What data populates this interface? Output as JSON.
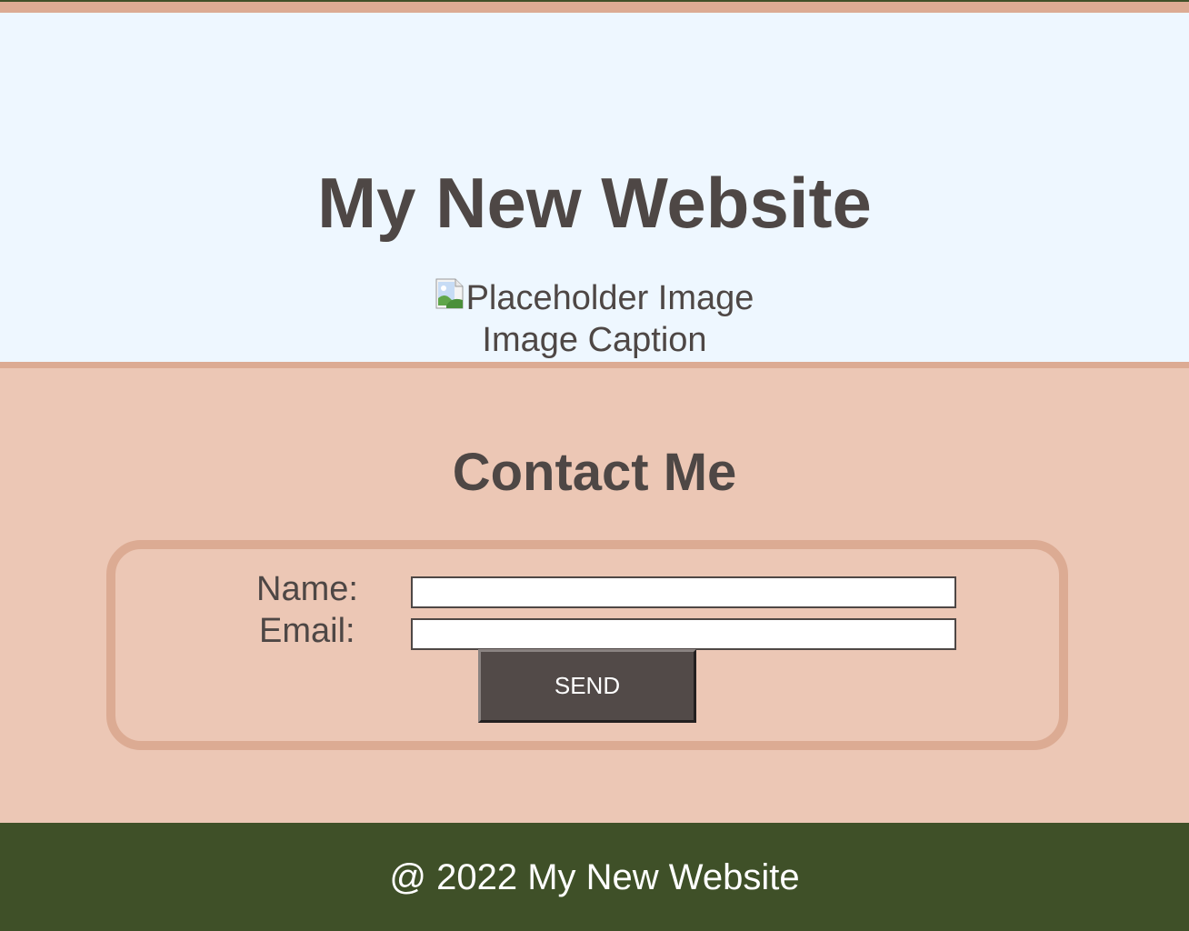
{
  "hero": {
    "title": "My New Website",
    "image_alt": "Placeholder Image",
    "caption": "Image Caption"
  },
  "contact": {
    "title": "Contact Me",
    "name_label": "Name:",
    "email_label": "Email:",
    "name_value": "",
    "email_value": "",
    "send_label": "SEND"
  },
  "footer": {
    "text": "@ 2022 My New Website"
  },
  "colors": {
    "accent_strip": "#dcab93",
    "hero_background": "#eef7ff",
    "contact_background": "#ecc7b5",
    "footer_background": "#3f5028",
    "text": "#4e4745",
    "button": "#524a48"
  },
  "icons": {
    "broken_image": "broken-image-icon"
  }
}
